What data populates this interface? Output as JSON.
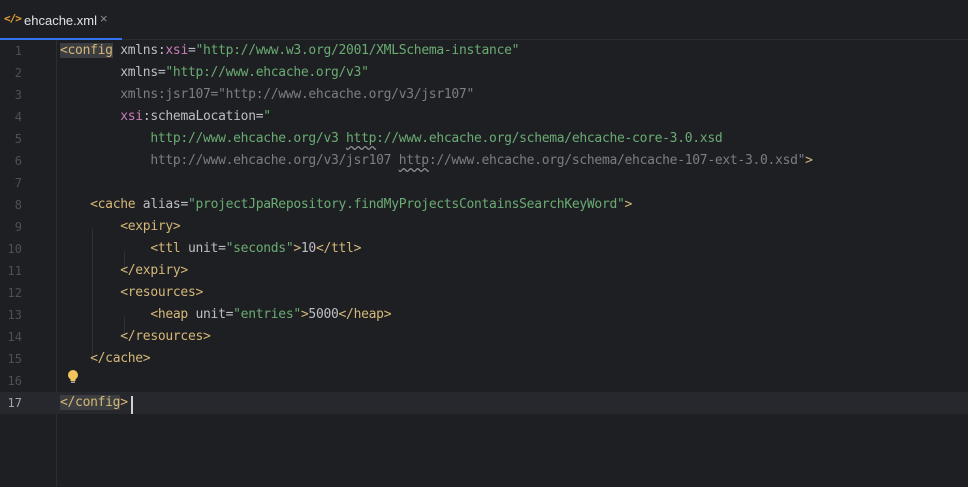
{
  "tab": {
    "icon": "</>",
    "label": "ehcache.xml",
    "close": "×"
  },
  "line_numbers": [
    "1",
    "2",
    "3",
    "4",
    "5",
    "6",
    "7",
    "8",
    "9",
    "10",
    "11",
    "12",
    "13",
    "14",
    "15",
    "16",
    "17"
  ],
  "code": {
    "l1": {
      "tag_open": "<config",
      "attr1": "xmlns",
      "colon": ":",
      "ns1": "xsi",
      "eq": "=",
      "val1": "\"http://www.w3.org/2001/XMLSchema-instance\""
    },
    "l2": {
      "attr": "xmlns",
      "eq": "=",
      "val": "\"http://www.ehcache.org/v3\""
    },
    "l3": {
      "text": "xmlns:jsr107=\"http://www.ehcache.org/v3/jsr107\""
    },
    "l4": {
      "ns": "xsi",
      "colon": ":",
      "attr": "schemaLocation",
      "eq": "=",
      "val": "\""
    },
    "l5": {
      "p1": "http://www.ehcache.org/v3 ",
      "p2": "http",
      "p3": "://www.ehcache.org/schema/ehcache-core-3.0.xsd"
    },
    "l6": {
      "p1": "http://www.ehcache.org/v3/jsr107 ",
      "p2": "http",
      "p3": "://www.ehcache.org/schema/ehcache-107-ext-3.0.xsd\"",
      "close": ">"
    },
    "l8": {
      "tag": "<cache",
      "attr": " alias",
      "eq": "=",
      "val": "\"projectJpaRepository.findMyProjectsContainsSearchKeyWord\"",
      "close": ">"
    },
    "l9": {
      "tag": "<expiry>"
    },
    "l10": {
      "tag": "<ttl",
      "attr": " unit",
      "eq": "=",
      "val": "\"seconds\"",
      "close": ">",
      "text": "10",
      "end": "</ttl>"
    },
    "l11": {
      "tag": "</expiry>"
    },
    "l12": {
      "tag": "<resources>"
    },
    "l13": {
      "tag": "<heap",
      "attr": " unit",
      "eq": "=",
      "val": "\"entries\"",
      "close": ">",
      "text": "5000",
      "end": "</heap>"
    },
    "l14": {
      "tag": "</resources>"
    },
    "l15": {
      "tag": "</cache>"
    },
    "l17": {
      "tag_open": "</config",
      "close": ">"
    }
  },
  "colors": {
    "tag": "#d5b778",
    "value": "#6aab73",
    "namespace": "#c77dbb",
    "accent": "#3574f0"
  }
}
